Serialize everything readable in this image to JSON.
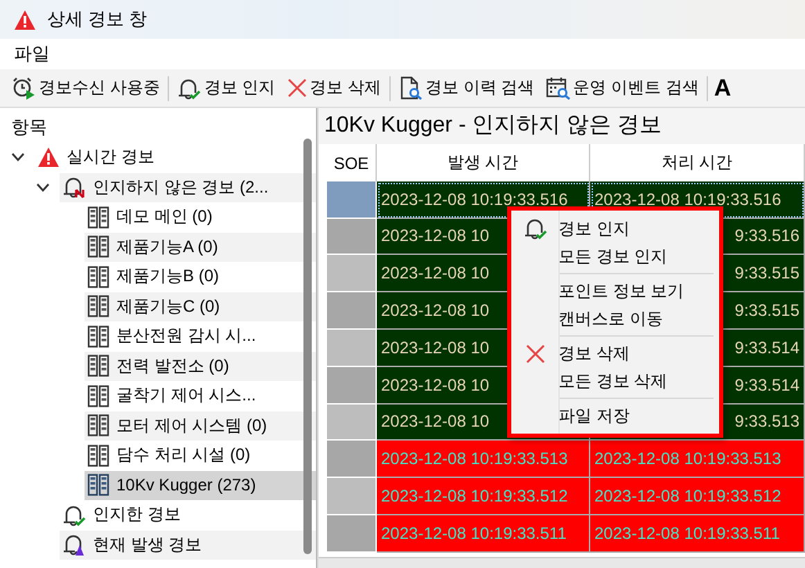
{
  "window": {
    "title": "상세 경보 창"
  },
  "menu": [
    "파일"
  ],
  "toolbar": [
    {
      "label": "경보수신 사용중",
      "kind": "receive"
    },
    {
      "label": "경보 인지",
      "kind": "acknowledge"
    },
    {
      "label": "경보 삭제",
      "kind": "delete"
    },
    {
      "label": "경보 이력 검색",
      "kind": "history"
    },
    {
      "label": "운영 이벤트 검색",
      "kind": "event"
    },
    {
      "label": "A",
      "kind": "text"
    }
  ],
  "sidebar": {
    "header": "항목",
    "items": [
      {
        "label": "실시간 경보",
        "kind": "realtime",
        "expanded": true,
        "selected": false,
        "children": [
          {
            "label": "인지하지 않은 경보 (2...",
            "kind": "unacknowledged",
            "expanded": true,
            "selected": false,
            "children": [
              {
                "label": "데모 메인 (0)",
                "kind": "station",
                "selected": false
              },
              {
                "label": "제품기능A (0)",
                "kind": "station",
                "selected": false
              },
              {
                "label": "제품기능B (0)",
                "kind": "station",
                "selected": false
              },
              {
                "label": "제품기능C (0)",
                "kind": "station",
                "selected": false
              },
              {
                "label": "분산전원 감시 시...",
                "kind": "station",
                "selected": false
              },
              {
                "label": "전력 발전소 (0)",
                "kind": "station",
                "selected": false
              },
              {
                "label": "굴착기 제어 시스...",
                "kind": "station",
                "selected": false
              },
              {
                "label": "모터 제어 시스템 (0)",
                "kind": "station",
                "selected": false
              },
              {
                "label": "담수 처리 시설 (0)",
                "kind": "station",
                "selected": false
              },
              {
                "label": "10Kv Kugger (273)",
                "kind": "station",
                "selected": true
              }
            ]
          },
          {
            "label": "인지한 경보",
            "kind": "acknowledged",
            "selected": false
          },
          {
            "label": "현재 발생 경보",
            "kind": "current",
            "selected": false
          }
        ]
      }
    ]
  },
  "table": {
    "title": "10Kv Kugger - 인지하지 않은 경보",
    "columns": [
      "SOE",
      "발생 시간",
      "처리 시간"
    ],
    "rows": [
      {
        "selected": true,
        "color": "#003300",
        "occurred": "2023-12-08 10:19:33.516",
        "handled": "2023-12-08 10:19:33.516"
      },
      {
        "selected": false,
        "color": "#003300",
        "occurred": "2023-12-08 10",
        "handled": "9:33.516"
      },
      {
        "selected": false,
        "color": "#003300",
        "occurred": "2023-12-08 10",
        "handled": "9:33.515"
      },
      {
        "selected": false,
        "color": "#003300",
        "occurred": "2023-12-08 10",
        "handled": "9:33.515"
      },
      {
        "selected": false,
        "color": "#003300",
        "occurred": "2023-12-08 10",
        "handled": "9:33.514"
      },
      {
        "selected": false,
        "color": "#003300",
        "occurred": "2023-12-08 10",
        "handled": "9:33.514"
      },
      {
        "selected": false,
        "color": "#003300",
        "occurred": "2023-12-08 10",
        "handled": "9:33.513"
      },
      {
        "selected": false,
        "color": "#ff0000",
        "occurred": "2023-12-08 10:19:33.513",
        "handled": "2023-12-08 10:19:33.513"
      },
      {
        "selected": false,
        "color": "#ff0000",
        "occurred": "2023-12-08 10:19:33.512",
        "handled": "2023-12-08 10:19:33.512"
      },
      {
        "selected": false,
        "color": "#ff0000",
        "occurred": "2023-12-08 10:19:33.511",
        "handled": "2023-12-08 10:19:33.511"
      }
    ]
  },
  "context_menu": {
    "groups": [
      [
        {
          "label": "경보 인지",
          "kind": "acknowledge"
        },
        {
          "label": "모든 경보 인지",
          "kind": "plain"
        }
      ],
      [
        {
          "label": "포인트 정보 보기",
          "kind": "plain"
        },
        {
          "label": "캔버스로 이동",
          "kind": "plain"
        }
      ],
      [
        {
          "label": "경보 삭제",
          "kind": "delete"
        },
        {
          "label": "모든 경보 삭제",
          "kind": "plain"
        }
      ],
      [
        {
          "label": "파일 저장",
          "kind": "plain"
        }
      ]
    ]
  }
}
